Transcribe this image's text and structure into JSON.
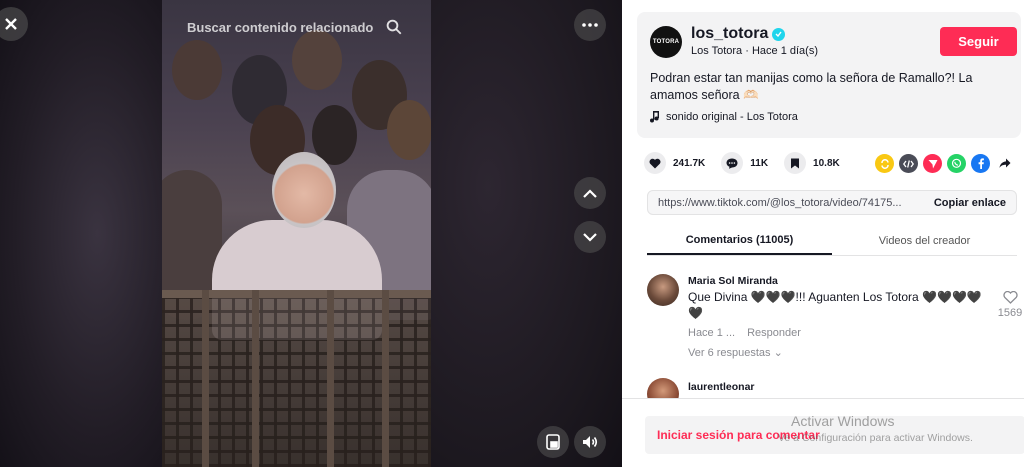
{
  "video": {
    "search_placeholder": "Buscar contenido relacionado",
    "icons": [
      "close-icon",
      "search-icon",
      "more-icon",
      "chevron-up-icon",
      "chevron-down-icon",
      "picture-in-picture-icon",
      "volume-icon"
    ]
  },
  "author": {
    "avatar_text": "TOTORA",
    "username": "los_totora",
    "display_name": "Los Totora",
    "separator": " · ",
    "posted": "Hace 1 día(s)",
    "follow_label": "Seguir"
  },
  "caption": "Podran estar tan manijas como la señora de Ramallo?! La amamos señora 🫶🏻",
  "music": "sonido original - Los Totora",
  "stats": {
    "likes": "241.7K",
    "comments": "11K",
    "saves": "10.8K"
  },
  "share": {
    "icons": [
      "repost-icon",
      "embed-icon",
      "send-icon",
      "whatsapp-icon",
      "facebook-icon",
      "share-arrow-icon"
    ],
    "colors": {
      "repost": "#f9c813",
      "embed": "#4a4c57",
      "send": "#fe2c55",
      "whatsapp": "#25d366",
      "facebook": "#1877f2"
    }
  },
  "link": {
    "url": "https://www.tiktok.com/@los_totora/video/74175...",
    "copy_label": "Copiar enlace"
  },
  "tabs": [
    {
      "label": "Comentarios (11005)",
      "active": true
    },
    {
      "label": "Videos del creador",
      "active": false
    }
  ],
  "comments": [
    {
      "name": "Maria Sol Miranda",
      "text": "Que Divina 🖤🖤🖤!!! Aguanten Los Totora 🖤🖤🖤🖤🖤",
      "time": "Hace 1 ...",
      "reply": "Responder",
      "replies": "Ver 6 respuestas ⌄",
      "likes": "1569"
    },
    {
      "name": "laurentleonar",
      "text": "",
      "time": "",
      "reply": "",
      "replies": "",
      "likes": ""
    }
  ],
  "login": {
    "label": "Iniciar sesión para comentar"
  },
  "windows_watermark": {
    "title": "Activar Windows",
    "subtitle": "Ve a Configuración para activar Windows."
  },
  "colors": {
    "accent": "#fe2c55",
    "verified": "#20d5ec",
    "text": "#161823"
  }
}
